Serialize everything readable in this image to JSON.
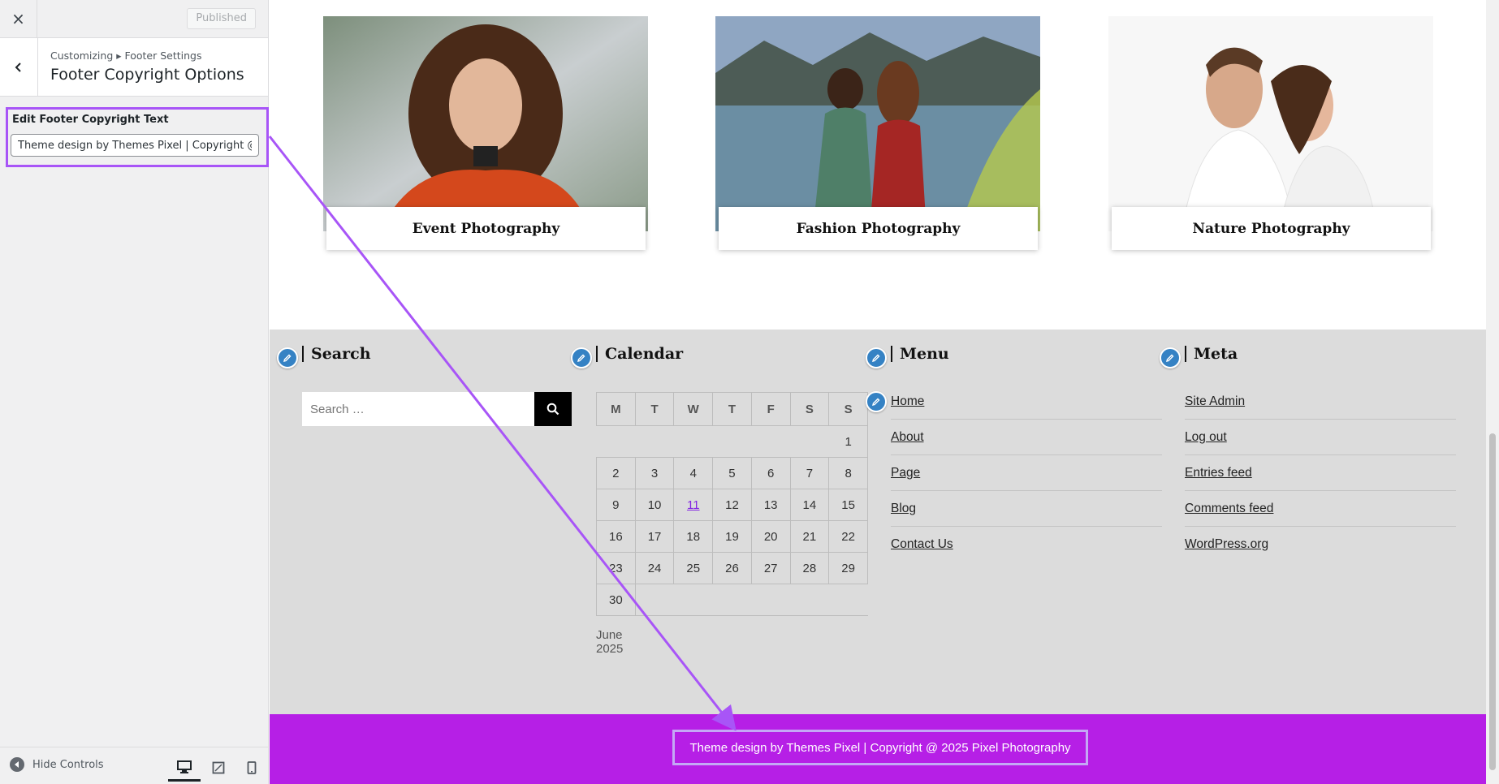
{
  "sidebar": {
    "close_label": "×",
    "publish_label": "Published",
    "breadcrumb": "Customizing ▸ Footer Settings",
    "section_title": "Footer Copyright Options",
    "control": {
      "label": "Edit Footer Copyright Text",
      "value": "Theme design by Themes Pixel | Copyright @ 2025 Pixel Photography"
    },
    "hide_controls_label": "Hide Controls"
  },
  "preview": {
    "cards": [
      {
        "title": "Event Photography"
      },
      {
        "title": "Fashion Photography"
      },
      {
        "title": "Nature Photography"
      }
    ],
    "widgets": {
      "search": {
        "title": "Search",
        "placeholder": "Search …"
      },
      "calendar": {
        "title": "Calendar",
        "days": [
          "M",
          "T",
          "W",
          "T",
          "F",
          "S",
          "S"
        ],
        "rows": [
          [
            "",
            "",
            "",
            "",
            "",
            "",
            "1"
          ],
          [
            "2",
            "3",
            "4",
            "5",
            "6",
            "7",
            "8"
          ],
          [
            "9",
            "10",
            "11",
            "12",
            "13",
            "14",
            "15"
          ],
          [
            "16",
            "17",
            "18",
            "19",
            "20",
            "21",
            "22"
          ],
          [
            "23",
            "24",
            "25",
            "26",
            "27",
            "28",
            "29"
          ],
          [
            "30",
            "",
            "",
            "",
            "",
            "",
            ""
          ]
        ],
        "linked_day": "11",
        "caption": "June 2025"
      },
      "menu": {
        "title": "Menu",
        "items": [
          "Home",
          "About",
          "Page",
          "Blog",
          "Contact Us"
        ]
      },
      "meta": {
        "title": "Meta",
        "items": [
          "Site Admin",
          "Log out",
          "Entries feed",
          "Comments feed",
          "WordPress.org"
        ]
      }
    },
    "footer_text": "Theme design by Themes Pixel | Copyright @ 2025 Pixel Photography"
  },
  "colors": {
    "footer_bg": "#b61fe6",
    "annotation": "#a855f7",
    "edit_pencil": "#3582c4",
    "calendar_link": "#8224e3"
  }
}
